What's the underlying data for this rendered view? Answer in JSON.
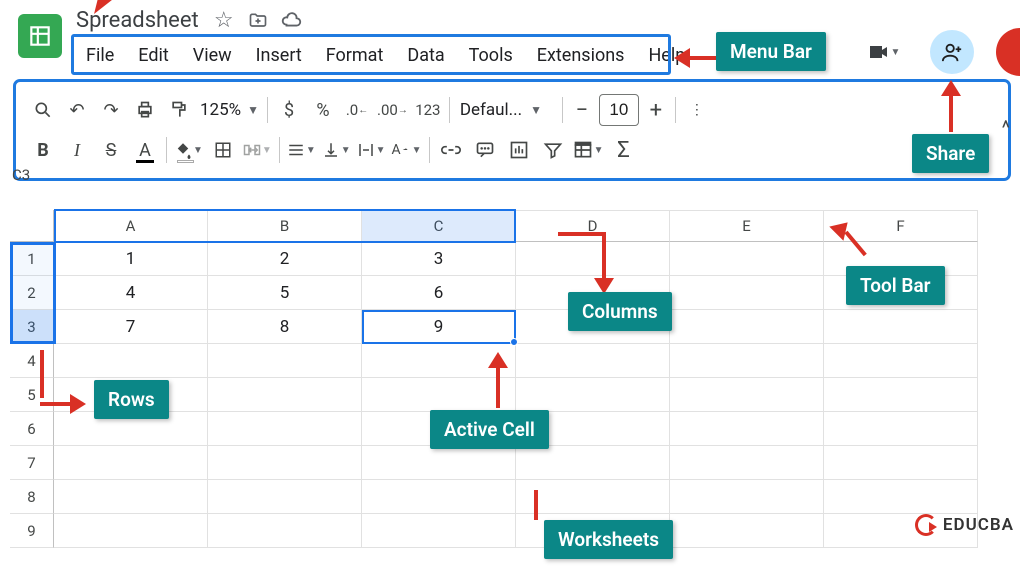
{
  "doc": {
    "title": "Spreadsheet"
  },
  "menu": {
    "file": "File",
    "edit": "Edit",
    "view": "View",
    "insert": "Insert",
    "format": "Format",
    "data": "Data",
    "tools": "Tools",
    "extensions": "Extensions",
    "help": "Help"
  },
  "toolbar": {
    "zoom": "125%",
    "font": "Defaul...",
    "font_size": "10",
    "number_123": "123"
  },
  "cell_address": "C3",
  "columns": {
    "A": "A",
    "B": "B",
    "C": "C",
    "D": "D",
    "E": "E",
    "F": "F"
  },
  "rows": {
    "r1": "1",
    "r2": "2",
    "r3": "3",
    "r4": "4",
    "r5": "5",
    "r6": "6",
    "r7": "7",
    "r8": "8",
    "r9": "9"
  },
  "cells": {
    "A1": "1",
    "B1": "2",
    "C1": "3",
    "A2": "4",
    "B2": "5",
    "C2": "6",
    "A3": "7",
    "B3": "8",
    "C3": "9"
  },
  "annotations": {
    "menu_bar": "Menu Bar",
    "share": "Share",
    "tool_bar": "Tool Bar",
    "rows": "Rows",
    "columns": "Columns",
    "active_cell": "Active Cell",
    "worksheets": "Worksheets"
  },
  "watermark": "EDUCBA"
}
